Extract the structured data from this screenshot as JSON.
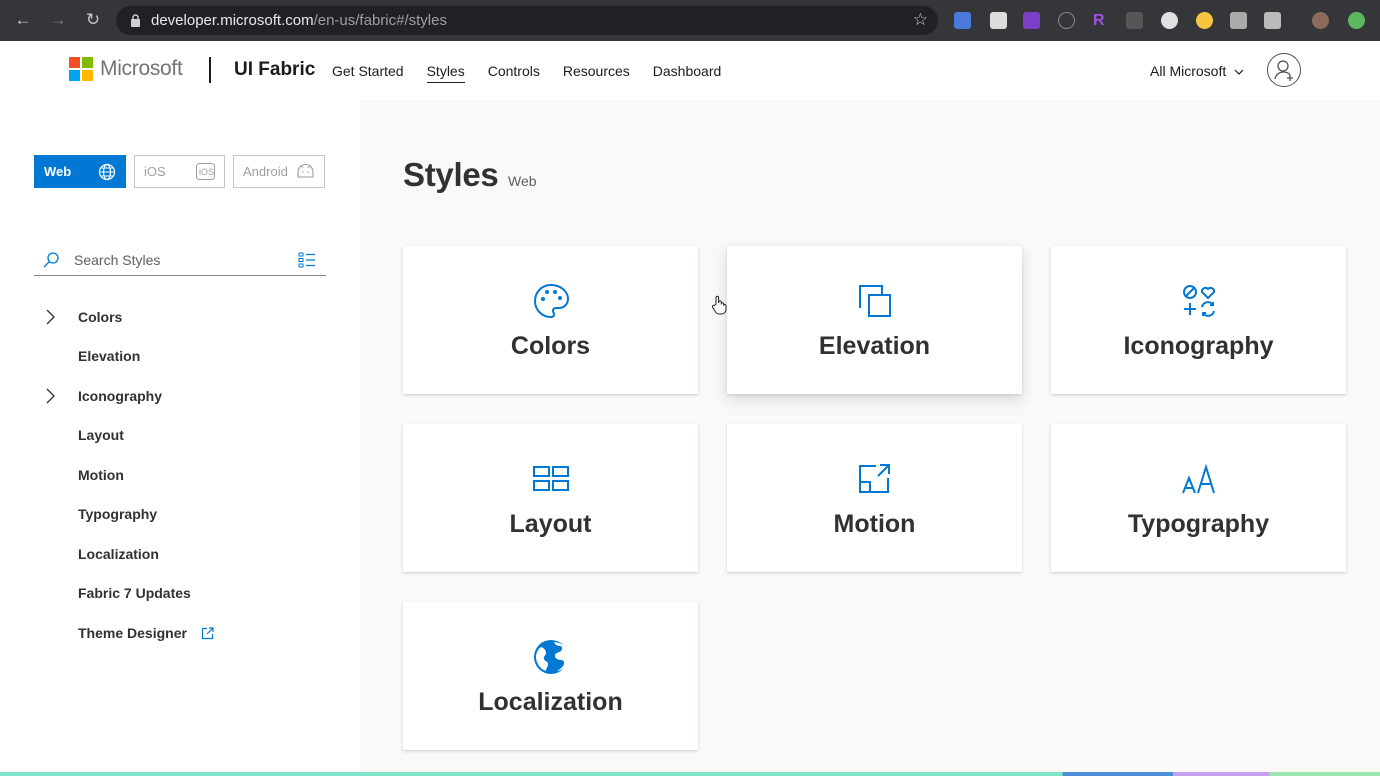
{
  "browser": {
    "url_host": "developer.microsoft.com",
    "url_path": "/en-us/fabric#/styles"
  },
  "header": {
    "ms_label": "Microsoft",
    "brand": "UI Fabric",
    "nav": [
      {
        "label": "Get Started"
      },
      {
        "label": "Styles"
      },
      {
        "label": "Controls"
      },
      {
        "label": "Resources"
      },
      {
        "label": "Dashboard"
      }
    ],
    "all_microsoft": "All Microsoft"
  },
  "sidebar": {
    "platforms": [
      {
        "label": "Web",
        "icon": "globe-icon",
        "active": true
      },
      {
        "label": "iOS",
        "icon": "ios-icon",
        "active": false
      },
      {
        "label": "Android",
        "icon": "android-icon",
        "active": false
      }
    ],
    "search_placeholder": "Search Styles",
    "items": [
      {
        "label": "Colors",
        "expandable": true
      },
      {
        "label": "Elevation",
        "expandable": false
      },
      {
        "label": "Iconography",
        "expandable": true
      },
      {
        "label": "Layout",
        "expandable": false
      },
      {
        "label": "Motion",
        "expandable": false
      },
      {
        "label": "Typography",
        "expandable": false
      },
      {
        "label": "Localization",
        "expandable": false
      },
      {
        "label": "Fabric 7 Updates",
        "expandable": false
      },
      {
        "label": "Theme Designer",
        "expandable": false,
        "external": true
      }
    ]
  },
  "main": {
    "title": "Styles",
    "subtitle": "Web",
    "cards": [
      {
        "label": "Colors",
        "icon": "palette-icon"
      },
      {
        "label": "Elevation",
        "icon": "elevation-icon"
      },
      {
        "label": "Iconography",
        "icon": "iconography-icon"
      },
      {
        "label": "Layout",
        "icon": "layout-icon"
      },
      {
        "label": "Motion",
        "icon": "motion-icon"
      },
      {
        "label": "Typography",
        "icon": "typography-icon"
      },
      {
        "label": "Localization",
        "icon": "globe-icon"
      }
    ]
  },
  "colors": {
    "accent": "#0078d4",
    "ms_red": "#f25022",
    "ms_green": "#7fba00",
    "ms_blue": "#00a4ef",
    "ms_yellow": "#ffb900"
  }
}
